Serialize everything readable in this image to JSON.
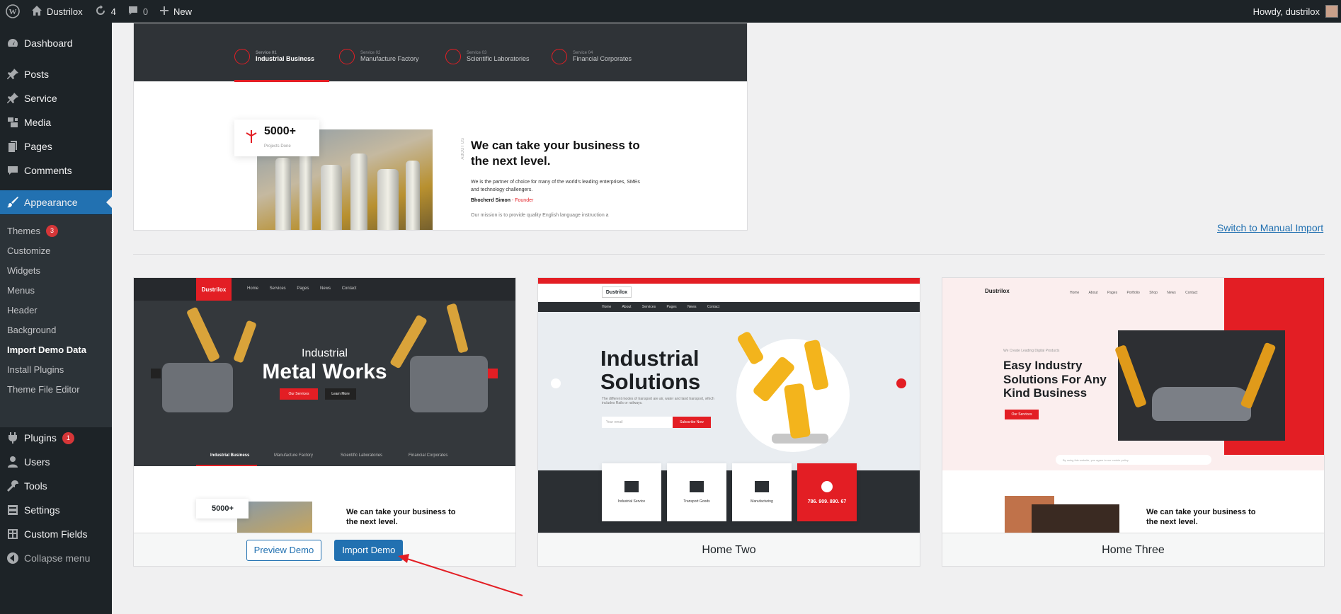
{
  "admin_bar": {
    "site_name": "Dustrilox",
    "updates_count": "4",
    "comments_count": "0",
    "new_label": "New",
    "howdy": "Howdy, dustrilox"
  },
  "sidebar": {
    "dashboard": "Dashboard",
    "posts": "Posts",
    "service": "Service",
    "media": "Media",
    "pages": "Pages",
    "comments": "Comments",
    "appearance": "Appearance",
    "sub": {
      "themes": "Themes",
      "themes_badge": "3",
      "customize": "Customize",
      "widgets": "Widgets",
      "menus": "Menus",
      "header": "Header",
      "background": "Background",
      "import_demo_data": "Import Demo Data",
      "install_plugins": "Install Plugins",
      "theme_file_editor": "Theme File Editor"
    },
    "plugins": "Plugins",
    "plugins_badge": "1",
    "users": "Users",
    "tools": "Tools",
    "settings": "Settings",
    "custom_fields": "Custom Fields",
    "collapse": "Collapse menu"
  },
  "top_preview": {
    "services": [
      {
        "small": "Service 01",
        "label": "Industrial Business"
      },
      {
        "small": "Service 02",
        "label": "Manufacture Factory"
      },
      {
        "small": "Service 03",
        "label": "Scientific Laboratories"
      },
      {
        "small": "Service 04",
        "label": "Financial Corporates"
      }
    ],
    "counter_value": "5000+",
    "counter_label": "Projects Done",
    "about_vertical": "ABOUT US",
    "heading": "We can take your business to the next level.",
    "paragraph": "We is the partner of choice for many of the world's leading enterprises, SMEs and technology challengers.",
    "author": "Bhocherd Simon",
    "author_role": "- Founder",
    "mission": "Our mission is to provide quality English language instruction a"
  },
  "manual_import_link": "Switch to Manual Import",
  "demos": [
    {
      "logo": "Dustrilox",
      "nav": "Home Services Pages News Contact",
      "hero_small": "Industrial",
      "hero_big": "Metal Works",
      "btn_services": "Our Services",
      "btn_learn": "Learn More",
      "services": [
        "Industrial Business",
        "Manufacture Factory",
        "Scientific Laboratories",
        "Financial Corporates"
      ],
      "counter": "5000+",
      "about": "We can take your business to the next level.",
      "preview_label": "Preview Demo",
      "import_label": "Import Demo"
    },
    {
      "logo": "Dustrilox",
      "nav": "Home About Services Pages News Contact",
      "hero": "Industrial Solutions",
      "sub": "The different modes of transport are air, water and land transport, which includes Rails or railways.",
      "input_placeholder": "Your email",
      "btn": "Subscribe Now",
      "features": [
        "Industrial Service",
        "Transport Goods",
        "Manufacturing"
      ],
      "phone": "786. 909. 890. 67",
      "name": "Home Two"
    },
    {
      "logo": "Dustrilox",
      "nav": "Home About Pages Portfolio Shop News Contact",
      "tag": "We Create Leading Digital Products",
      "hero": "Easy Industry Solutions For Any Kind Business",
      "btn": "Our Services",
      "search": "By using this website, you agree to our cookie policy",
      "about": "We can take your business to the next level.",
      "name": "Home Three"
    }
  ]
}
